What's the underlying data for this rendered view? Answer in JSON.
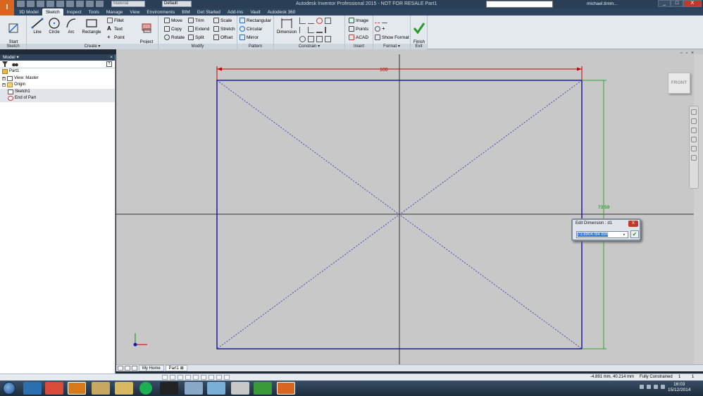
{
  "titlebar": {
    "app_letter": "I",
    "material": "Material",
    "appearance": "Default",
    "title": "Autodesk Inventor Professional 2015 - NOT FOR RESALE   Part1",
    "user": "michael.timm...",
    "minimize": "_",
    "restore": "□",
    "close": "X"
  },
  "tabs": [
    "3D Model",
    "Sketch",
    "Inspect",
    "Tools",
    "Manage",
    "View",
    "Environments",
    "BIM",
    "Get Started",
    "Add-Ins",
    "Vault",
    "Autodesk 360"
  ],
  "ribbon": {
    "start_2d_sketch": "Start\n2D Sketch",
    "line": "Line",
    "circle": "Circle",
    "arc": "Arc",
    "rectangle": "Rectangle",
    "fillet": "Fillet",
    "text": "Text",
    "point": "Point",
    "project_geometry": "Project\nGeometry",
    "move": "Move",
    "copy": "Copy",
    "rotate": "Rotate",
    "trim": "Trim",
    "extend": "Extend",
    "split": "Split",
    "scale": "Scale",
    "stretch": "Stretch",
    "offset": "Offset",
    "rect_pattern": "Rectangular",
    "circular": "Circular",
    "mirror": "Mirror",
    "dimension": "Dimension",
    "image": "Image",
    "points": "Points",
    "acad": "ACAD",
    "show_format": "Show Format",
    "finish_sketch": "Finish\nSketch",
    "panels": {
      "sketch": "Sketch",
      "create": "Create ▾",
      "modify": "Modify",
      "pattern": "Pattern",
      "constrain": "Constrain ▾",
      "insert": "Insert",
      "format": "Format ▾",
      "exit": "Exit"
    }
  },
  "browser": {
    "header": "Model ▾",
    "close": "×",
    "help": "?",
    "items": [
      {
        "label": "Part1",
        "icon": "part-icon"
      },
      {
        "label": "View: Master",
        "icon": "view-icon"
      },
      {
        "label": "Origin",
        "icon": "folder-icon"
      },
      {
        "label": "Sketch1",
        "icon": "sketch-icon"
      },
      {
        "label": "End of Part",
        "icon": "end-of-part-icon"
      }
    ]
  },
  "canvas": {
    "dim_width": "100",
    "dim_height": "73.59",
    "viewcube": "FRONT",
    "background": "#c8c8c8",
    "sketch_color": "#1a1aa8",
    "dim_color": "#cc0000",
    "dim_green": "#2aa82a"
  },
  "edit_dimension": {
    "title": "Edit Dimension : d1",
    "close": "X",
    "value": "73.6904784 mm"
  },
  "doctabs": {
    "home": "My Home",
    "part": "Part1",
    "part_close": "⊠"
  },
  "status": {
    "coords": "-4.891 mm, 40.214 mm",
    "constraint": "Fully Constrained",
    "n1": "1",
    "n2": "1"
  },
  "taskbar": {
    "time": "16:03",
    "date": "15/12/2014"
  }
}
